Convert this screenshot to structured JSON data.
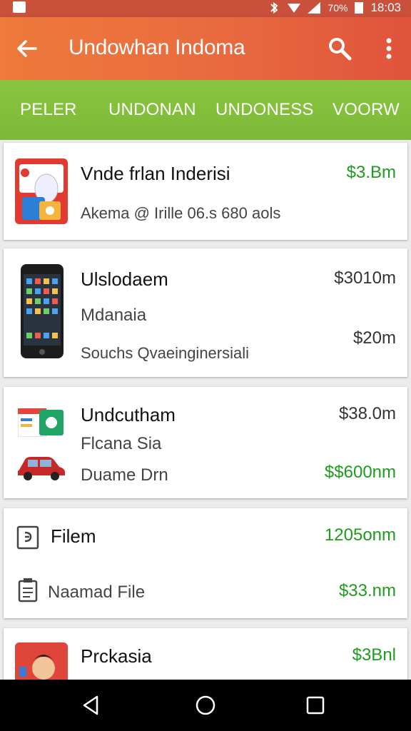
{
  "status_bar": {
    "battery_text": "70%",
    "time": "18:03"
  },
  "app_bar": {
    "title": "Undowhan Indoma"
  },
  "tabs": [
    {
      "label": "PELER"
    },
    {
      "label": "UNDONAN"
    },
    {
      "label": "UNDONESS"
    },
    {
      "label": "VOORW"
    }
  ],
  "items": [
    {
      "title": "Vnde frlan Inderisi",
      "subtitle": "Akema @ Irille 06.s 680 aols",
      "price": "$3.Bm"
    },
    {
      "title": "Ulslodaem",
      "line2": "Mdanaia",
      "line3": "Souchs Qvaeinginersiali",
      "price": "$3010m",
      "price2": "$20m"
    },
    {
      "title": "Undcutham",
      "line2": "Flcana Sia",
      "line3": "Duame Drn",
      "price": "$38.0m",
      "price2": "$$600nm"
    },
    {
      "title": "Filem",
      "line2": "Naamad File",
      "price": "1205onm",
      "price2": "$33.nm"
    },
    {
      "title": "Prckasia",
      "price": "$3Bnl"
    }
  ],
  "colors": {
    "appbar": "#e86a3e",
    "tabs": "#84bf3b",
    "green_price": "#1e9c1e"
  },
  "icons": [
    "back-arrow-icon",
    "search-icon",
    "more-vert-icon",
    "nav-back-icon",
    "nav-home-icon",
    "nav-recents-icon"
  ]
}
